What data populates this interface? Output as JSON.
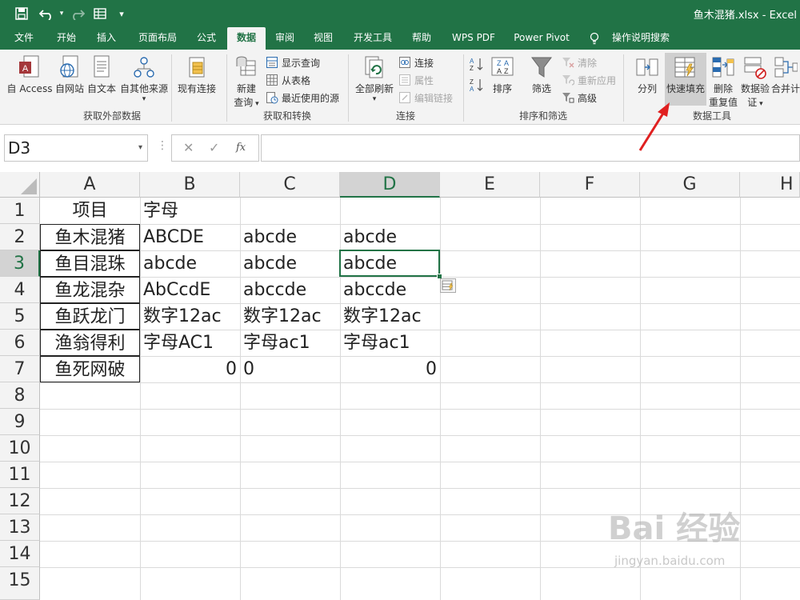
{
  "window": {
    "title": "鱼木混猪.xlsx  -  Excel"
  },
  "quick_access": {
    "save_icon": "save-icon",
    "undo_icon": "undo-icon",
    "redo_icon": "redo-icon",
    "form_icon": "form-icon",
    "customize_icon": "customize-qat-icon"
  },
  "tabs": [
    "文件",
    "开始",
    "插入",
    "页面布局",
    "公式",
    "数据",
    "审阅",
    "视图",
    "开发工具",
    "帮助",
    "WPS PDF",
    "Power Pivot",
    "操作说明搜索"
  ],
  "active_tab": "数据",
  "ribbon": {
    "get_external": {
      "label": "获取外部数据",
      "from_access": "自 Access",
      "from_web": "自网站",
      "from_text": "自文本",
      "from_other": "自其他来源",
      "existing": "现有连接"
    },
    "get_transform": {
      "label": "获取和转换",
      "new_query_1": "新建",
      "new_query_2": "查询",
      "show_queries": "显示查询",
      "from_table": "从表格",
      "recent_sources": "最近使用的源"
    },
    "connections": {
      "label": "连接",
      "refresh_all": "全部刷新",
      "connections": "连接",
      "properties": "属性",
      "edit_links": "编辑链接"
    },
    "sort_filter": {
      "label": "排序和筛选",
      "sort": "排序",
      "filter": "筛选",
      "clear": "清除",
      "reapply": "重新应用",
      "advanced": "高级"
    },
    "data_tools": {
      "label": "数据工具",
      "text_to_columns": "分列",
      "flash_fill": "快速填充",
      "remove_dup_1": "删除",
      "remove_dup_2": "重复值",
      "validation_1": "数据验",
      "validation_2": "证",
      "consolidate": "合并计"
    }
  },
  "formula_bar": {
    "name_box": "D3",
    "cancel_symbol": "✕",
    "enter_symbol": "✓",
    "fx_symbol": "fx",
    "formula": ""
  },
  "columns": [
    "A",
    "B",
    "C",
    "D",
    "E",
    "F",
    "G",
    "H"
  ],
  "selected_column": "D",
  "rows": [
    "1",
    "2",
    "3",
    "4",
    "5",
    "6",
    "7",
    "8",
    "9",
    "10",
    "11",
    "12",
    "13",
    "14",
    "15"
  ],
  "selected_row": "3",
  "cells": {
    "r1": [
      "项目",
      "字母",
      "",
      ""
    ],
    "r2": [
      "鱼木混猪",
      "ABCDE",
      "abcde",
      "abcde"
    ],
    "r3": [
      "鱼目混珠",
      "abcde",
      "abcde",
      "abcde"
    ],
    "r4": [
      "鱼龙混杂",
      "AbCcdE",
      "abccde",
      "abccde"
    ],
    "r5": [
      "鱼跃龙门",
      "数字12ac",
      "数字12ac",
      "数字12ac"
    ],
    "r6": [
      "渔翁得利",
      "字母AC1",
      "字母ac1",
      "字母ac1"
    ],
    "r7": [
      "鱼死网破",
      "0",
      "0",
      "0"
    ]
  },
  "watermark": {
    "brand": "Bai 经验",
    "url": "jingyan.baidu.com"
  },
  "colors": {
    "excel_green": "#217346",
    "arrow_red": "#e02020"
  }
}
